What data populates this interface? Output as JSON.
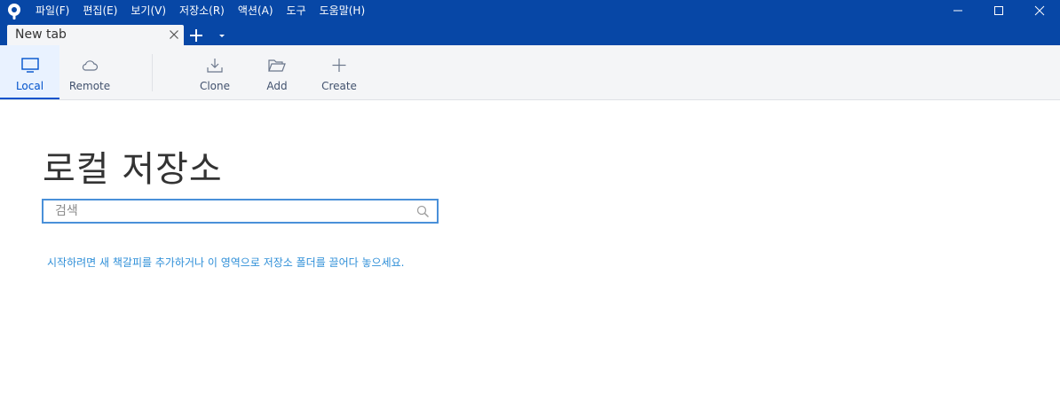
{
  "menu": {
    "items": [
      {
        "label": "파일(F)"
      },
      {
        "label": "편집(E)"
      },
      {
        "label": "보기(V)"
      },
      {
        "label": "저장소(R)"
      },
      {
        "label": "액션(A)"
      },
      {
        "label": "도구"
      },
      {
        "label": "도움말(H)"
      }
    ]
  },
  "tabs": [
    {
      "label": "New tab",
      "active": true
    }
  ],
  "toolbar": {
    "items": [
      {
        "label": "Local",
        "icon": "monitor-icon",
        "active": true
      },
      {
        "label": "Remote",
        "icon": "cloud-icon",
        "active": false
      },
      {
        "label": "Clone",
        "icon": "download-icon",
        "active": false
      },
      {
        "label": "Add",
        "icon": "folder-open-icon",
        "active": false
      },
      {
        "label": "Create",
        "icon": "plus-icon",
        "active": false
      }
    ]
  },
  "main": {
    "title": "로컬 저장소",
    "search": {
      "placeholder": "검색",
      "value": ""
    },
    "hint": "시작하려면 새 책갈피를 추가하거나 이 영역으로 저장소 폴더를 끌어다 놓으세요."
  },
  "colors": {
    "titlebar": "#0747a6",
    "toolbar": "#f4f5f7",
    "accent": "#0052cc",
    "hint": "#2f8fd8"
  }
}
